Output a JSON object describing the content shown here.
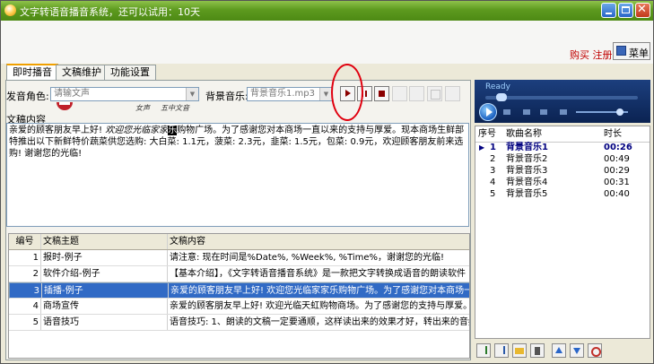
{
  "window": {
    "title": "文字转语音播音系统，还可以试用：10天"
  },
  "header": {
    "buy_link": "购买",
    "register_link": "注册",
    "menu_button": "菜单"
  },
  "tabs": [
    {
      "label": "即时播音",
      "active": true
    },
    {
      "label": "文稿维护",
      "active": false
    },
    {
      "label": "功能设置",
      "active": false
    }
  ],
  "controls": {
    "role_label": "发音角色:",
    "role_value": "请输文声",
    "bgm_label": "背景音乐:",
    "bgm_value": "背景音乐1.mp3",
    "small_text_1": "女声",
    "small_text_2": "五中文音"
  },
  "editor": {
    "label": "文稿内容",
    "text_before": "亲爱的顾客朋友早上好! ",
    "text_italic": "欢迎您光临家家",
    "text_highlight": "乐",
    "text_after": "购物广场。为了感谢您对本商场一直以来的支持与厚爱。现本商场生鲜部特推出以下新鲜特价蔬菜供您选购: 大白菜: 1.1元，菠菜: 2.3元，韭菜: 1.5元，包菜: 0.9元，欢迎顾客朋友前来选购! 谢谢您的光临!"
  },
  "grid": {
    "columns": [
      "编号",
      "文稿主题",
      "文稿内容"
    ],
    "rows": [
      {
        "id": "1",
        "topic": "报时-例子",
        "content": "请注意: 现在时间是%Date%, %Week%, %Time%，谢谢您的光临!"
      },
      {
        "id": "2",
        "topic": "软件介绍-例子",
        "content": "【基本介绍】，《文字转语音播音系统》是一款把文字转换成语音的朗读软件"
      },
      {
        "id": "3",
        "topic": "插播-例子",
        "content": "亲爱的顾客朋友早上好! 欢迎您光临家家乐购物广场。为了感谢您对本商场一直"
      },
      {
        "id": "4",
        "topic": "商场宣传",
        "content": "亲爱的顾客朋友早上好! 欢迎光临天虹购物商场。为了感谢您的支持与厚爱。我"
      },
      {
        "id": "5",
        "topic": "语音技巧",
        "content": "语音技巧: 1、朗读的文稿一定要通顺，这样读出来的效果才好，转出来的音频"
      }
    ],
    "selected_index": 2
  },
  "player": {
    "status": "Ready",
    "columns": [
      "序号",
      "歌曲名称",
      "时长"
    ],
    "tracks": [
      {
        "no": "1",
        "title": "背景音乐1",
        "duration": "00:26",
        "current": true
      },
      {
        "no": "2",
        "title": "背景音乐2",
        "duration": "00:49",
        "current": false
      },
      {
        "no": "3",
        "title": "背景音乐3",
        "duration": "00:29",
        "current": false
      },
      {
        "no": "4",
        "title": "背景音乐4",
        "duration": "00:31",
        "current": false
      },
      {
        "no": "5",
        "title": "背景音乐5",
        "duration": "00:40",
        "current": false
      }
    ],
    "current_marker": "▶"
  },
  "colors": {
    "titlebar": "#5d9a1f",
    "selection": "#316ac5",
    "annotation": "#e0000f",
    "link": "#c00000"
  }
}
